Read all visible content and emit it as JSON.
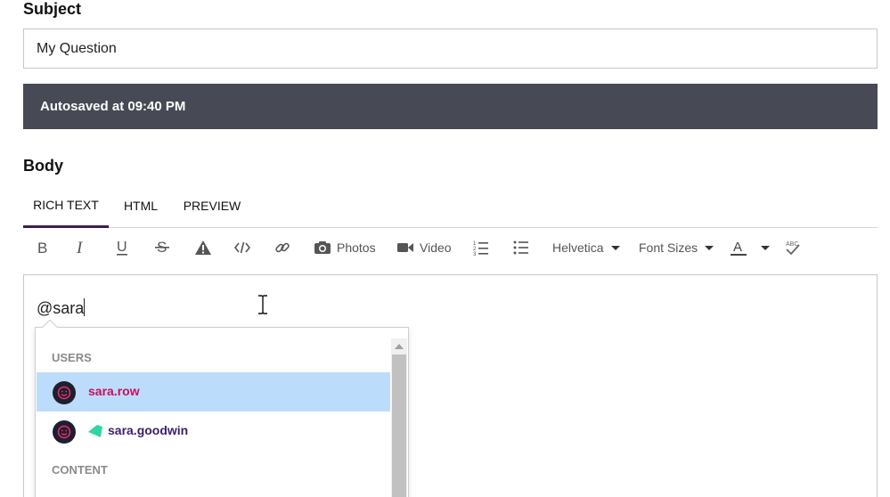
{
  "subject": {
    "label": "Subject",
    "value": "My Question"
  },
  "autosave": {
    "text": "Autosaved at 09:40 PM"
  },
  "body": {
    "label": "Body"
  },
  "tabs": [
    {
      "label": "RICH TEXT",
      "active": true
    },
    {
      "label": "HTML",
      "active": false
    },
    {
      "label": "PREVIEW",
      "active": false
    }
  ],
  "toolbar": {
    "photos_label": "Photos",
    "video_label": "Video",
    "font_family": "Helvetica",
    "font_sizes_label": "Font Sizes",
    "icons": [
      "bold-icon",
      "italic-icon",
      "underline-icon",
      "strikethrough-icon",
      "warning-icon",
      "code-icon",
      "link-icon",
      "camera-icon",
      "video-icon",
      "ordered-list-icon",
      "bulleted-list-icon",
      "text-color-icon",
      "spellcheck-icon"
    ]
  },
  "editor": {
    "text": "@sara"
  },
  "mention_dropdown": {
    "users_header": "USERS",
    "content_header": "CONTENT",
    "users": [
      {
        "name": "sara.row",
        "selected": true
      },
      {
        "name": "sara.goodwin",
        "selected": false
      }
    ]
  },
  "colors": {
    "autosave_bg": "#474a54",
    "selected_row": "#bcdcfb",
    "username_primary": "#c8105a",
    "username_secondary": "#3a1f6b",
    "rank_icon": "#2fd6a0",
    "avatar_face": "#e8306e"
  }
}
